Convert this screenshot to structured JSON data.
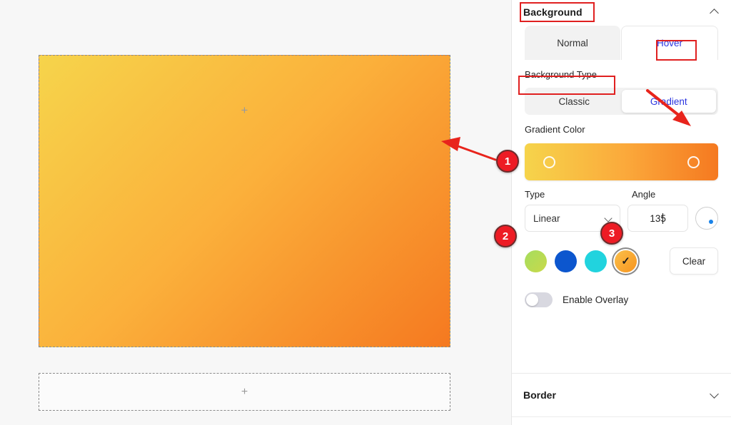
{
  "canvas": {
    "hero_plus": "+",
    "empty_plus": "+",
    "hero_gradient_from": "#F6D44B",
    "hero_gradient_to": "#F57920"
  },
  "panel": {
    "header": {
      "title": "Background",
      "collapse_icon": "chevron-up"
    },
    "state_tabs": [
      {
        "label": "Normal",
        "active": false
      },
      {
        "label": "Hover",
        "active": true
      }
    ],
    "background_type": {
      "label": "Background Type",
      "options": [
        {
          "label": "Classic",
          "active": false
        },
        {
          "label": "Gradient",
          "active": true
        }
      ]
    },
    "gradient_color": {
      "label": "Gradient Color",
      "stop_start": "#F6D44B",
      "stop_end": "#F57920"
    },
    "type": {
      "label": "Type",
      "value": "Linear"
    },
    "angle": {
      "label": "Angle",
      "value": "135",
      "dial_color": "#1a83e8"
    },
    "swatches": [
      {
        "name": "swatch-green",
        "color": "#8CD24A",
        "selected": false
      },
      {
        "name": "swatch-blue",
        "color": "#0C56CE",
        "selected": false
      },
      {
        "name": "swatch-cyan",
        "color": "#21D3DE",
        "selected": false
      },
      {
        "name": "swatch-orange",
        "color": "#F9A32E",
        "selected": true,
        "check": "✓"
      }
    ],
    "clear_button": "Clear",
    "overlay": {
      "label": "Enable Overlay",
      "enabled": false
    },
    "border_section": {
      "title": "Border",
      "expand_icon": "chevron-down"
    }
  },
  "annotations": {
    "accent_color": "#e02020",
    "badges": [
      {
        "number": "1"
      },
      {
        "number": "2"
      },
      {
        "number": "3"
      }
    ],
    "highlight_boxes": [
      "Background",
      "Hover",
      "Background Type"
    ]
  }
}
